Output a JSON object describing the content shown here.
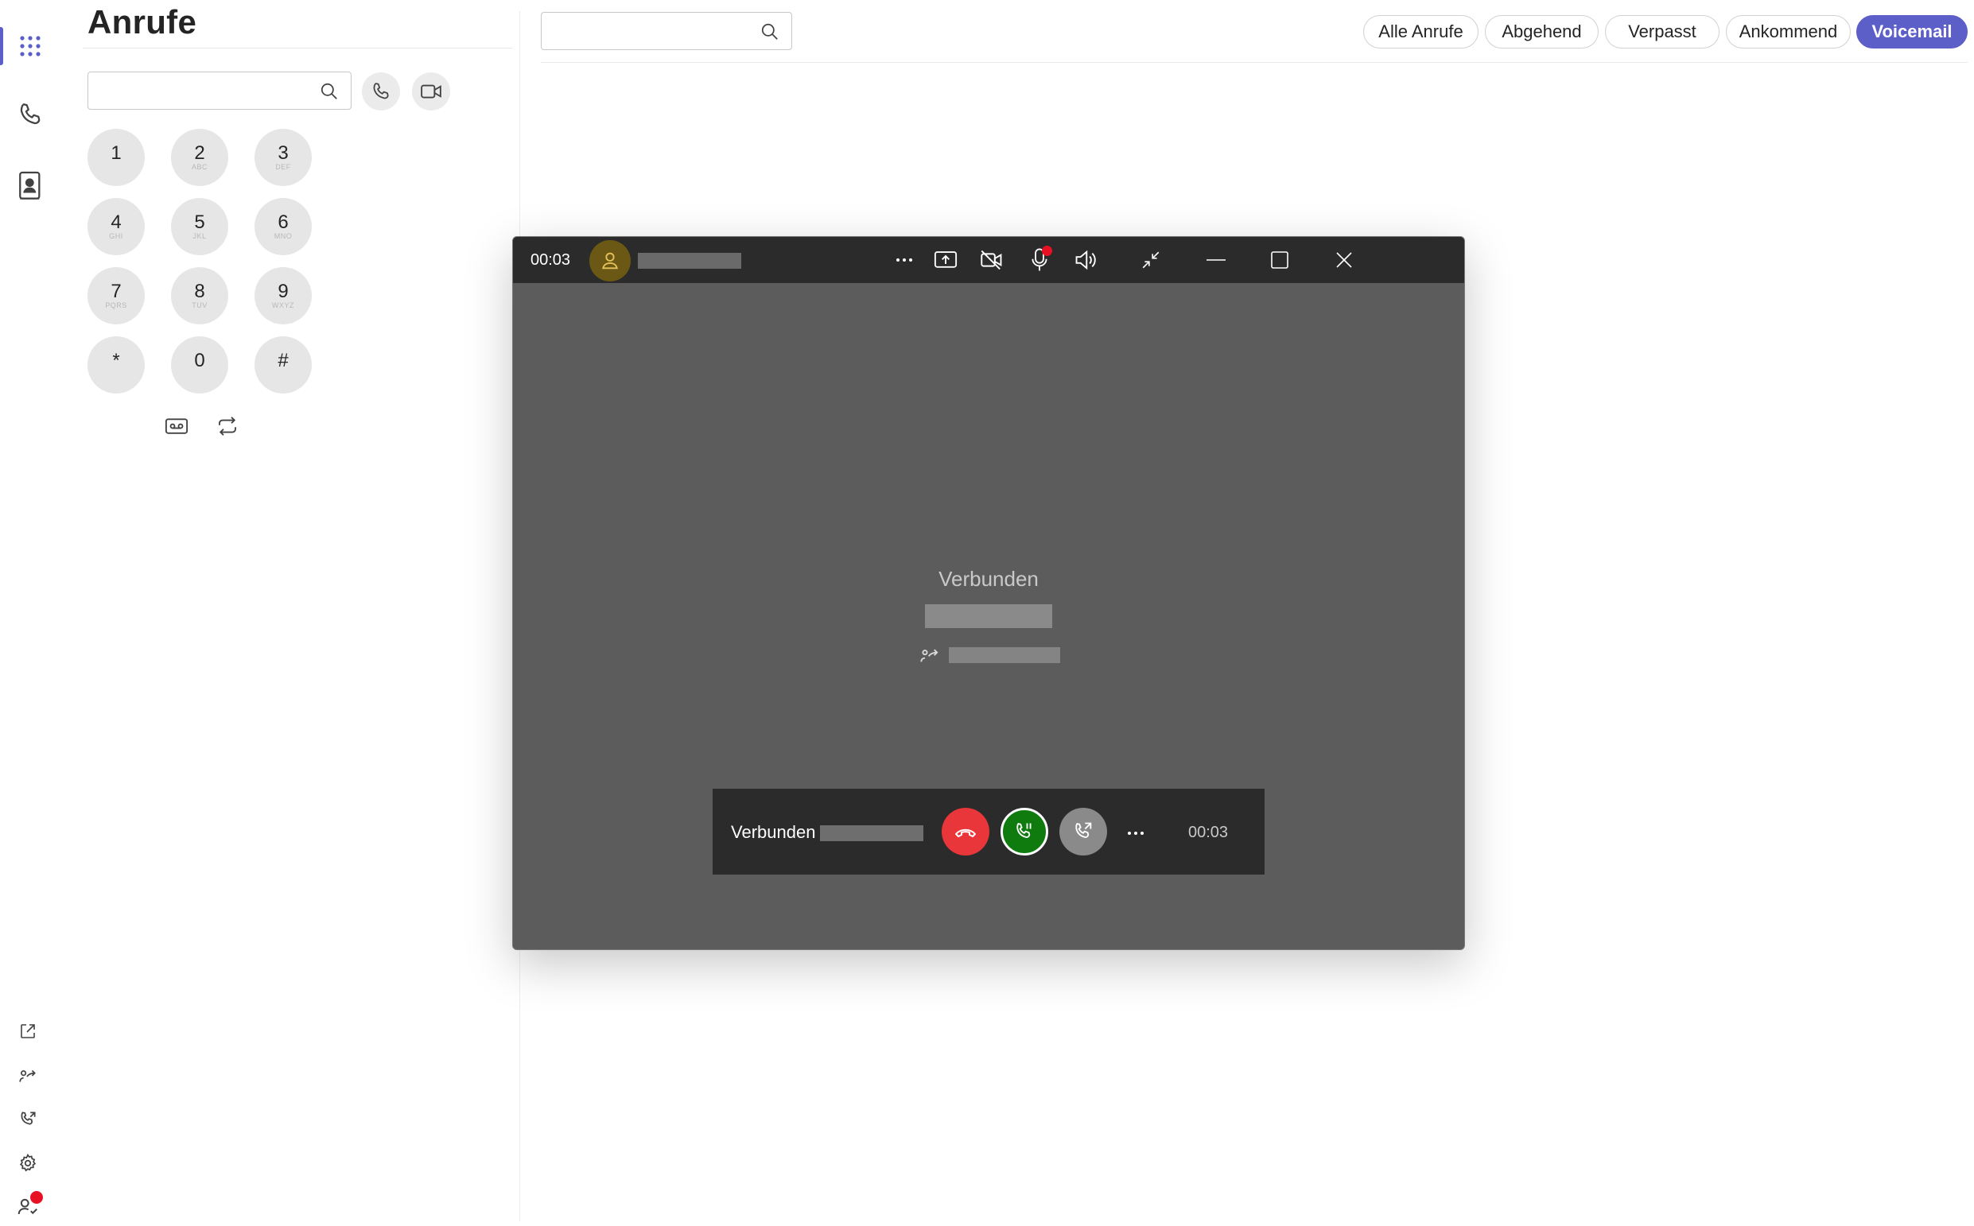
{
  "panel": {
    "title": "Anrufe",
    "dial_placeholder": "",
    "keypad": [
      {
        "num": "1",
        "sub": ""
      },
      {
        "num": "2",
        "sub": "ABC"
      },
      {
        "num": "3",
        "sub": "DEF"
      },
      {
        "num": "4",
        "sub": "GHI"
      },
      {
        "num": "5",
        "sub": "JKL"
      },
      {
        "num": "6",
        "sub": "MNO"
      },
      {
        "num": "7",
        "sub": "PQRS"
      },
      {
        "num": "8",
        "sub": "TUV"
      },
      {
        "num": "9",
        "sub": "WXYZ"
      },
      {
        "num": "*",
        "sub": ""
      },
      {
        "num": "0",
        "sub": ""
      },
      {
        "num": "#",
        "sub": ""
      }
    ]
  },
  "top": {
    "search_placeholder": "",
    "filters": [
      {
        "label": "Alle Anrufe",
        "active": false
      },
      {
        "label": "Abgehend",
        "active": false
      },
      {
        "label": "Verpasst",
        "active": false
      },
      {
        "label": "Ankommend",
        "active": false
      },
      {
        "label": "Voicemail",
        "active": true
      }
    ]
  },
  "call": {
    "timer": "00:03",
    "status": "Verbunden",
    "strip_label": "Verbunden",
    "strip_timer": "00:03"
  },
  "icons": {
    "rail": [
      "apps-grid-icon",
      "phone-icon",
      "contacts-icon"
    ],
    "rail_bottom": [
      "open-external-icon",
      "call-forward-icon",
      "call-park-icon",
      "settings-icon",
      "user-status-icon"
    ],
    "call_bar": [
      "more-icon",
      "share-screen-icon",
      "camera-off-icon",
      "microphone-icon",
      "speaker-icon",
      "exit-fullscreen-icon",
      "minimize-icon",
      "maximize-icon",
      "close-icon"
    ]
  },
  "colors": {
    "accent": "#5b5fc7",
    "hangup": "#e8363a",
    "hold_active": "#0f7b0f",
    "call_bg": "#5c5c5c",
    "call_bar": "#2b2b2b",
    "avatar": "#6b5814",
    "status_dot": "#e81123"
  }
}
